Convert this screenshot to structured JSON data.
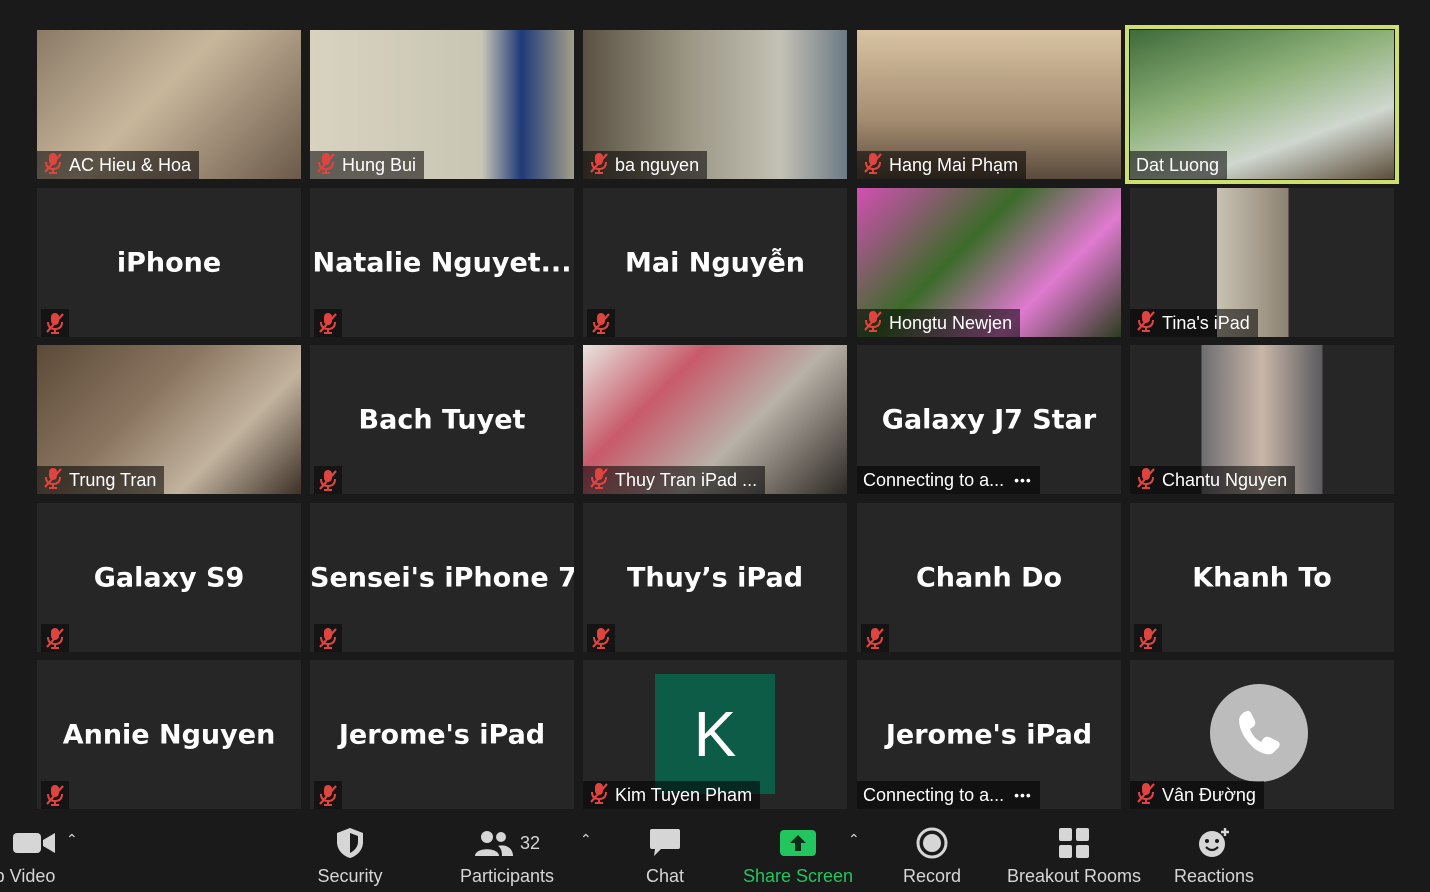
{
  "participants": [
    {
      "name": "AC Hieu & Hoa",
      "mode": "video"
    },
    {
      "name": "Hung Bui",
      "mode": "video"
    },
    {
      "name": "ba nguyen",
      "mode": "video"
    },
    {
      "name": "Hang Mai Phạm",
      "mode": "video"
    },
    {
      "name": "Dat Luong",
      "mode": "video",
      "active_speaker": true
    },
    {
      "name": "iPhone",
      "mode": "name"
    },
    {
      "name": "Natalie  Nguyet...",
      "mode": "name"
    },
    {
      "name": "Mai Nguyễn",
      "mode": "name"
    },
    {
      "name": "Hongtu Newjen",
      "mode": "video"
    },
    {
      "name": "Tina's iPad",
      "mode": "video"
    },
    {
      "name": "Trung Tran",
      "mode": "video"
    },
    {
      "name": "Bach Tuyet",
      "mode": "name"
    },
    {
      "name": "Thuy Tran iPad ...",
      "mode": "video"
    },
    {
      "name": "Galaxy J7 Star",
      "mode": "connecting",
      "status": "Connecting to a..."
    },
    {
      "name": "Chantu Nguyen",
      "mode": "video"
    },
    {
      "name": "Galaxy S9",
      "mode": "name"
    },
    {
      "name": "Sensei's iPhone 7",
      "mode": "name"
    },
    {
      "name": "Thuy’s iPad",
      "mode": "name"
    },
    {
      "name": "Chanh Do",
      "mode": "name"
    },
    {
      "name": "Khanh To",
      "mode": "name"
    },
    {
      "name": "Annie Nguyen",
      "mode": "name"
    },
    {
      "name": "Jerome's iPad",
      "mode": "name"
    },
    {
      "name": "Kim Tuyen Pham",
      "mode": "avatar",
      "initial": "K"
    },
    {
      "name": "Jerome's iPad",
      "mode": "connecting",
      "status": "Connecting to a..."
    },
    {
      "name": "Vân Đường",
      "mode": "phone"
    }
  ],
  "toolbar": {
    "video_label": "p Video",
    "security_label": "Security",
    "participants_label": "Participants",
    "participants_count": "32",
    "chat_label": "Chat",
    "share_label": "Share Screen",
    "record_label": "Record",
    "breakout_label": "Breakout Rooms",
    "reactions_label": "Reactions"
  },
  "colors": {
    "active_speaker_border": "#cde06b",
    "mute_red": "#e0443f",
    "share_green": "#22c55e",
    "tile_bg": "#262626",
    "avatar_green": "#0d5c47"
  }
}
